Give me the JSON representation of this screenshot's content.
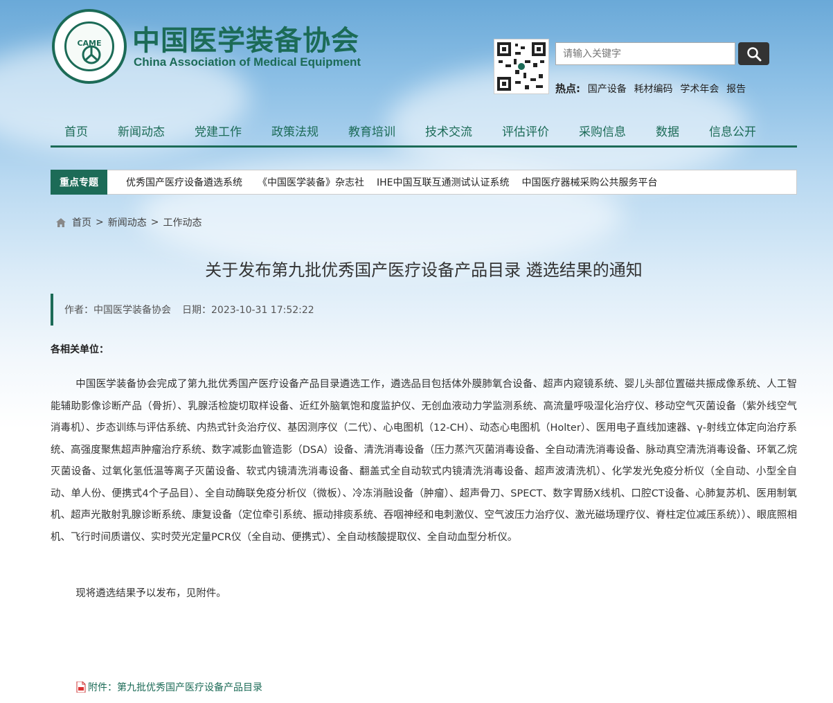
{
  "header": {
    "logo_text": "CAME",
    "brand_cn": "中国医学装备协会",
    "brand_en": "China Association of Medical Equipment"
  },
  "search": {
    "placeholder": "请输入关键字",
    "hot_label": "热点:",
    "hot_links": [
      "国产设备",
      "耗材编码",
      "学术年会",
      "报告"
    ]
  },
  "nav": [
    "首页",
    "新闻动态",
    "党建工作",
    "政策法规",
    "教育培训",
    "技术交流",
    "评估评价",
    "采购信息",
    "数据",
    "信息公开"
  ],
  "topics": {
    "tag": "重点专题",
    "links": [
      "优秀国产医疗设备遴选系统",
      "《中国医学装备》杂志社",
      "IHE中国互联互通测试认证系统",
      "中国医疗器械采购公共服务平台"
    ]
  },
  "breadcrumb": [
    "首页",
    "新闻动态",
    "工作动态"
  ],
  "article": {
    "title": "关于发布第九批优秀国产医疗设备产品目录 遴选结果的通知",
    "author": "作者：中国医学装备协会",
    "date": "日期：2023-10-31 17:52:22",
    "salutation": "各相关单位：",
    "paragraph1": "中国医学装备协会完成了第九批优秀国产医疗设备产品目录遴选工作，遴选品目包括体外膜肺氧合设备、超声内窥镜系统、婴儿头部位置磁共振成像系统、人工智能辅助影像诊断产品（骨折）、乳腺活检旋切取样设备、近红外脑氧饱和度监护仪、无创血液动力学监测系统、高流量呼吸湿化治疗仪、移动空气灭菌设备（紫外线空气消毒机）、步态训练与评估系统、内热式针灸治疗仪、基因测序仪（二代）、心电图机（12-CH）、动态心电图机（Holter）、医用电子直线加速器、γ-射线立体定向治疗系统、高强度聚焦超声肿瘤治疗系统、数字减影血管造影（DSA）设备、清洗消毒设备（压力蒸汽灭菌消毒设备、全自动清洗消毒设备、脉动真空清洗消毒设备、环氧乙烷灭菌设备、过氧化氢低温等离子灭菌设备、软式内镜清洗消毒设备、翻盖式全自动软式内镜清洗消毒设备、超声波清洗机）、化学发光免疫分析仪（全自动、小型全自动、单人份、便携式4个子品目）、全自动酶联免疫分析仪（微板）、冷冻消融设备（肿瘤）、超声骨刀、SPECT、数字胃肠X线机、口腔CT设备、心肺复苏机、医用制氧机、超声光散射乳腺诊断系统、康复设备（定位牵引系统、振动排痰系统、吞咽神经和电刺激仪、空气波压力治疗仪、激光磁场理疗仪、脊柱定位减压系统））、眼底照相机、飞行时间质谱仪、实时荧光定量PCR仪（全自动、便携式）、全自动核酸提取仪、全自动血型分析仪。",
    "paragraph2": "现将遴选结果予以发布，见附件。",
    "attachment": "附件：第九批优秀国产医疗设备产品目录"
  },
  "colors": {
    "brand_green": "#1c6b57",
    "sky_blue": "#6aa9d8"
  }
}
